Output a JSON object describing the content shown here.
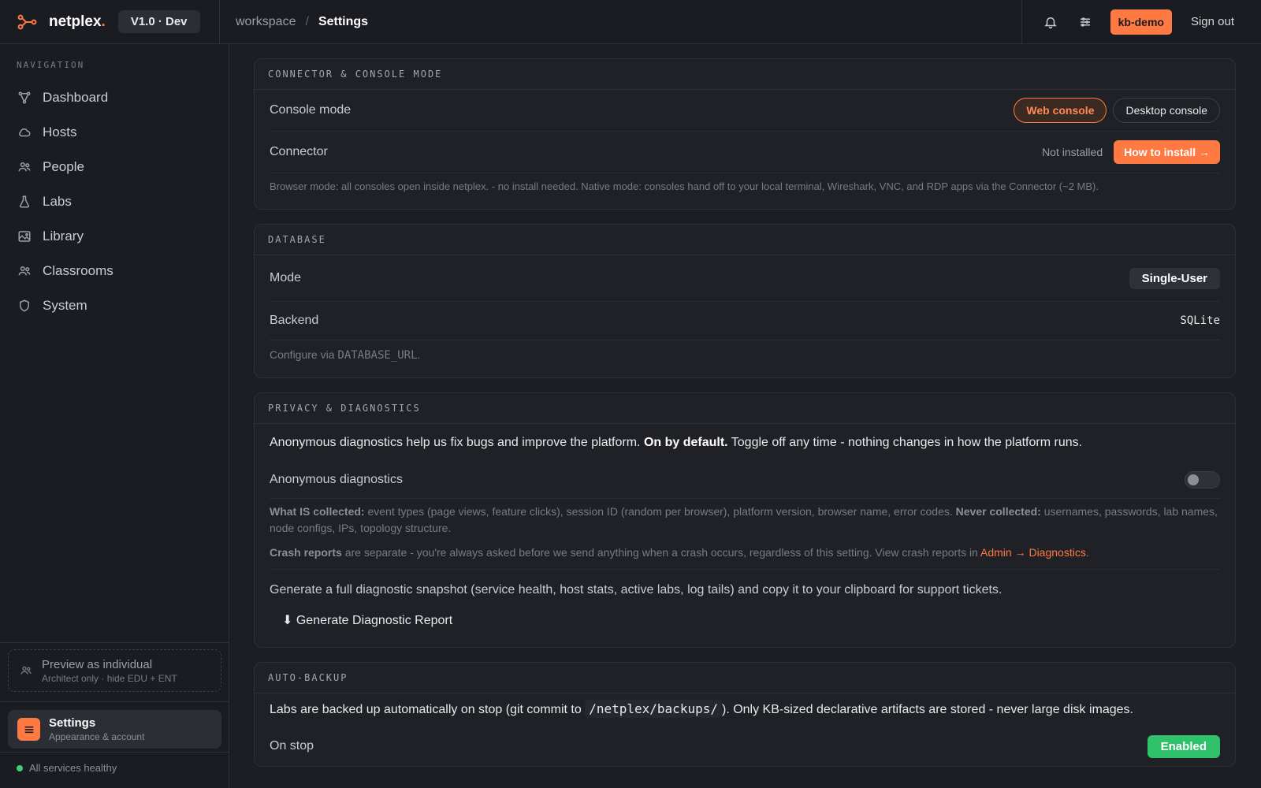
{
  "app": {
    "name": "netplex",
    "version": "V1.0 · Dev"
  },
  "breadcrumb": {
    "workspace": "workspace",
    "separator": "/",
    "current": "Settings"
  },
  "topbar": {
    "user": "kb-demo",
    "sign_out": "Sign out",
    "icons": [
      "bell-icon",
      "sliders-icon"
    ]
  },
  "sidebar": {
    "heading": "NAVIGATION",
    "items": [
      {
        "label": "Dashboard",
        "icon": "graph-icon"
      },
      {
        "label": "Hosts",
        "icon": "cloud-icon"
      },
      {
        "label": "People",
        "icon": "people-icon"
      },
      {
        "label": "Labs",
        "icon": "flask-icon"
      },
      {
        "label": "Library",
        "icon": "image-icon"
      },
      {
        "label": "Classrooms",
        "icon": "people-icon"
      },
      {
        "label": "System",
        "icon": "shield-icon"
      }
    ],
    "preview": {
      "title": "Preview as individual",
      "subtitle": "Architect only · hide EDU + ENT"
    },
    "settings": {
      "title": "Settings",
      "subtitle": "Appearance & account"
    },
    "health": "All services healthy"
  },
  "connector_card": {
    "title": "CONNECTOR & CONSOLE MODE",
    "console_label": "Console mode",
    "console_options": [
      "Web console",
      "Desktop console"
    ],
    "console_selected": "Web console",
    "connector_label": "Connector",
    "connector_status": "Not installed",
    "install_button": "How to install →",
    "note": "Browser mode: all consoles open inside netplex. - no install needed. Native mode: consoles hand off to your local terminal, Wireshark, VNC, and RDP apps via the Connector (~2 MB)."
  },
  "database_card": {
    "title": "DATABASE",
    "mode_label": "Mode",
    "mode_value": "Single-User",
    "backend_label": "Backend",
    "backend_value": "SQLite",
    "note_prefix": "Configure via",
    "note_code": "DATABASE_URL",
    "note_suffix": "."
  },
  "privacy_card": {
    "title": "PRIVACY & DIAGNOSTICS",
    "intro_prefix": "Anonymous diagnostics help us fix bugs and improve the platform.",
    "intro_bold": "On by default.",
    "intro_suffix": "Toggle off any time - nothing changes in how the platform runs.",
    "toggle_label": "Anonymous diagnostics",
    "toggle_on": false,
    "collected_label": "What IS collected:",
    "collected_text": "event types (page views, feature clicks), session ID (random per browser), platform version, browser name, error codes.",
    "never_label": "Never collected:",
    "never_text": "usernames, passwords, lab names, node configs, IPs, topology structure.",
    "crash_label": "Crash reports",
    "crash_text": "are separate - you're always asked before we send anything when a crash occurs, regardless of this setting. View crash reports in",
    "crash_link": "Admin → Diagnostics",
    "crash_end": ".",
    "snapshot_text": "Generate a full diagnostic snapshot (service health, host stats, active labs, log tails) and copy it to your clipboard for support tickets.",
    "generate_button": "⬇ Generate Diagnostic Report"
  },
  "backup_card": {
    "title": "AUTO-BACKUP",
    "intro_prefix": "Labs are backed up automatically on stop (git commit to",
    "intro_code": "/netplex/backups/",
    "intro_suffix": "). Only KB-sized declarative artifacts are stored - never large disk images.",
    "on_stop_label": "On stop",
    "on_stop_value": "Enabled"
  },
  "colors": {
    "accent": "#ff7a42",
    "success": "#2fc26a",
    "background": "#1c1e23"
  }
}
